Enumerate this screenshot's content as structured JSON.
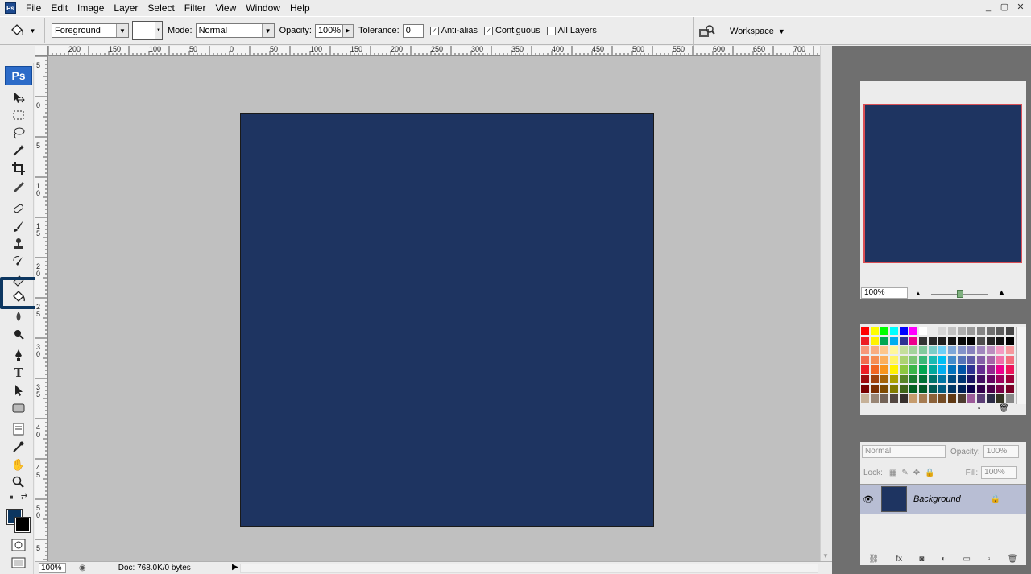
{
  "app": {
    "logo": "Ps",
    "menu": [
      "File",
      "Edit",
      "Image",
      "Layer",
      "Select",
      "Filter",
      "View",
      "Window",
      "Help"
    ],
    "window_controls": [
      "_",
      "▢",
      "✕"
    ]
  },
  "options_bar": {
    "fill_source": "Foreground",
    "mode_label": "Mode:",
    "mode_value": "Normal",
    "opacity_label": "Opacity:",
    "opacity_value": "100%",
    "tolerance_label": "Tolerance:",
    "tolerance_value": "0",
    "anti_alias_label": "Anti-alias",
    "anti_alias_checked": true,
    "contiguous_label": "Contiguous",
    "contiguous_checked": true,
    "all_layers_label": "All Layers",
    "all_layers_checked": false,
    "workspace_label": "Workspace"
  },
  "ruler": {
    "top_labels": [
      "200",
      "150",
      "100",
      "50",
      "0",
      "50",
      "100",
      "150",
      "200",
      "250",
      "300",
      "350",
      "400",
      "450",
      "500",
      "550",
      "600",
      "650",
      "700"
    ],
    "left_labels": [
      "5",
      "0",
      "5",
      "1 0",
      "1 5",
      "2 0",
      "2 5",
      "3 0",
      "3 5",
      "4 0",
      "4 5",
      "5 0",
      "5"
    ]
  },
  "canvas": {
    "fill_color": "#1e3461",
    "background_color": "#c0c0c0"
  },
  "status": {
    "zoom": "100%",
    "doc_info": "Doc: 768.0K/0 bytes"
  },
  "toolbox": {
    "foreground_color": "#0c3660",
    "background_color": "#000000",
    "tools": [
      "move-icon",
      "marquee-icon",
      "lasso-icon",
      "magic-wand-icon",
      "crop-icon",
      "slice-icon",
      "healing-brush-icon",
      "brush-icon",
      "clone-stamp-icon",
      "history-brush-icon",
      "eraser-icon",
      "paint-bucket-icon",
      "blur-icon",
      "dodge-icon",
      "pen-icon",
      "type-icon",
      "path-selection-icon",
      "shape-icon",
      "notes-icon",
      "eyedropper-icon",
      "hand-icon",
      "zoom-icon"
    ],
    "active_tool": "paint-bucket-icon"
  },
  "navigator": {
    "zoom": "100%"
  },
  "layers": {
    "blend_mode": "Normal",
    "opacity_label": "Opacity:",
    "opacity_value": "100%",
    "lock_label": "Lock:",
    "fill_label": "Fill:",
    "fill_value": "100%",
    "layer_name": "Background"
  }
}
